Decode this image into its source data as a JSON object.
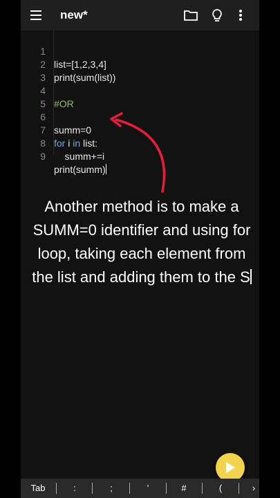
{
  "appbar": {
    "title": "new*"
  },
  "editor": {
    "lines": [
      {
        "num": "1",
        "code": "list=[1,2,3,4]"
      },
      {
        "num": "2",
        "code": "print(sum(list))"
      },
      {
        "num": "3",
        "code": ""
      },
      {
        "num": "4",
        "code": "#OR"
      },
      {
        "num": "5",
        "code": ""
      },
      {
        "num": "6",
        "code": "summ=0"
      },
      {
        "num": "7",
        "kw1": "for",
        "mid1": " i ",
        "kw2": "in",
        "rest": " list:"
      },
      {
        "num": "8",
        "code": "    summ+=i"
      },
      {
        "num": "9",
        "code": "print(summ)"
      }
    ]
  },
  "caption": {
    "text": "Another method is to make a SUMM=0 identifier and using for loop, taking each element from the list and adding them to the S"
  },
  "keybar": {
    "keys": [
      "Tab",
      ":",
      ";",
      "'",
      "#",
      "(",
      "›"
    ]
  },
  "colors": {
    "accent": "#f2d34f",
    "arrow": "#e0203a",
    "keyword": "#6fa8e0",
    "comment": "#8fbf6b"
  }
}
